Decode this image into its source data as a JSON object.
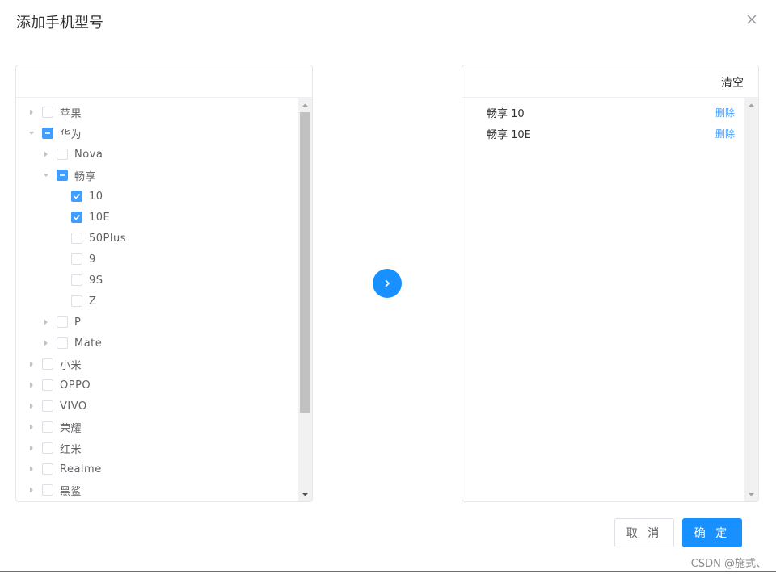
{
  "dialog": {
    "title": "添加手机型号"
  },
  "left_panel": {
    "tree": [
      {
        "label": "苹果",
        "level": 0,
        "expandable": true,
        "expanded": false,
        "state": "unchecked"
      },
      {
        "label": "华为",
        "level": 0,
        "expandable": true,
        "expanded": true,
        "state": "half"
      },
      {
        "label": "Nova",
        "level": 1,
        "expandable": true,
        "expanded": false,
        "state": "unchecked"
      },
      {
        "label": "畅享",
        "level": 1,
        "expandable": true,
        "expanded": true,
        "state": "half"
      },
      {
        "label": "10",
        "level": 2,
        "expandable": false,
        "expanded": false,
        "state": "checked"
      },
      {
        "label": "10E",
        "level": 2,
        "expandable": false,
        "expanded": false,
        "state": "checked"
      },
      {
        "label": "50Plus",
        "level": 2,
        "expandable": false,
        "expanded": false,
        "state": "unchecked"
      },
      {
        "label": "9",
        "level": 2,
        "expandable": false,
        "expanded": false,
        "state": "unchecked"
      },
      {
        "label": "9S",
        "level": 2,
        "expandable": false,
        "expanded": false,
        "state": "unchecked"
      },
      {
        "label": "Z",
        "level": 2,
        "expandable": false,
        "expanded": false,
        "state": "unchecked"
      },
      {
        "label": "P",
        "level": 1,
        "expandable": true,
        "expanded": false,
        "state": "unchecked"
      },
      {
        "label": "Mate",
        "level": 1,
        "expandable": true,
        "expanded": false,
        "state": "unchecked"
      },
      {
        "label": "小米",
        "level": 0,
        "expandable": true,
        "expanded": false,
        "state": "unchecked"
      },
      {
        "label": "OPPO",
        "level": 0,
        "expandable": true,
        "expanded": false,
        "state": "unchecked"
      },
      {
        "label": "VIVO",
        "level": 0,
        "expandable": true,
        "expanded": false,
        "state": "unchecked"
      },
      {
        "label": "荣耀",
        "level": 0,
        "expandable": true,
        "expanded": false,
        "state": "unchecked"
      },
      {
        "label": "红米",
        "level": 0,
        "expandable": true,
        "expanded": false,
        "state": "unchecked"
      },
      {
        "label": "Realme",
        "level": 0,
        "expandable": true,
        "expanded": false,
        "state": "unchecked"
      },
      {
        "label": "黑鲨",
        "level": 0,
        "expandable": true,
        "expanded": false,
        "state": "unchecked"
      }
    ],
    "scroll_position": 0.0,
    "scroll_visible_fraction": 0.8
  },
  "right_panel": {
    "clear_label": "清空",
    "selected": [
      {
        "label": "畅享 10",
        "delete_label": "删除"
      },
      {
        "label": "畅享 10E",
        "delete_label": "删除"
      }
    ]
  },
  "footer": {
    "cancel_label": "取 消",
    "confirm_label": "确 定"
  },
  "watermark": "CSDN @施式、",
  "colors": {
    "primary": "#1890ff",
    "checkbox": "#409eff",
    "border": "#e6e6e6"
  }
}
